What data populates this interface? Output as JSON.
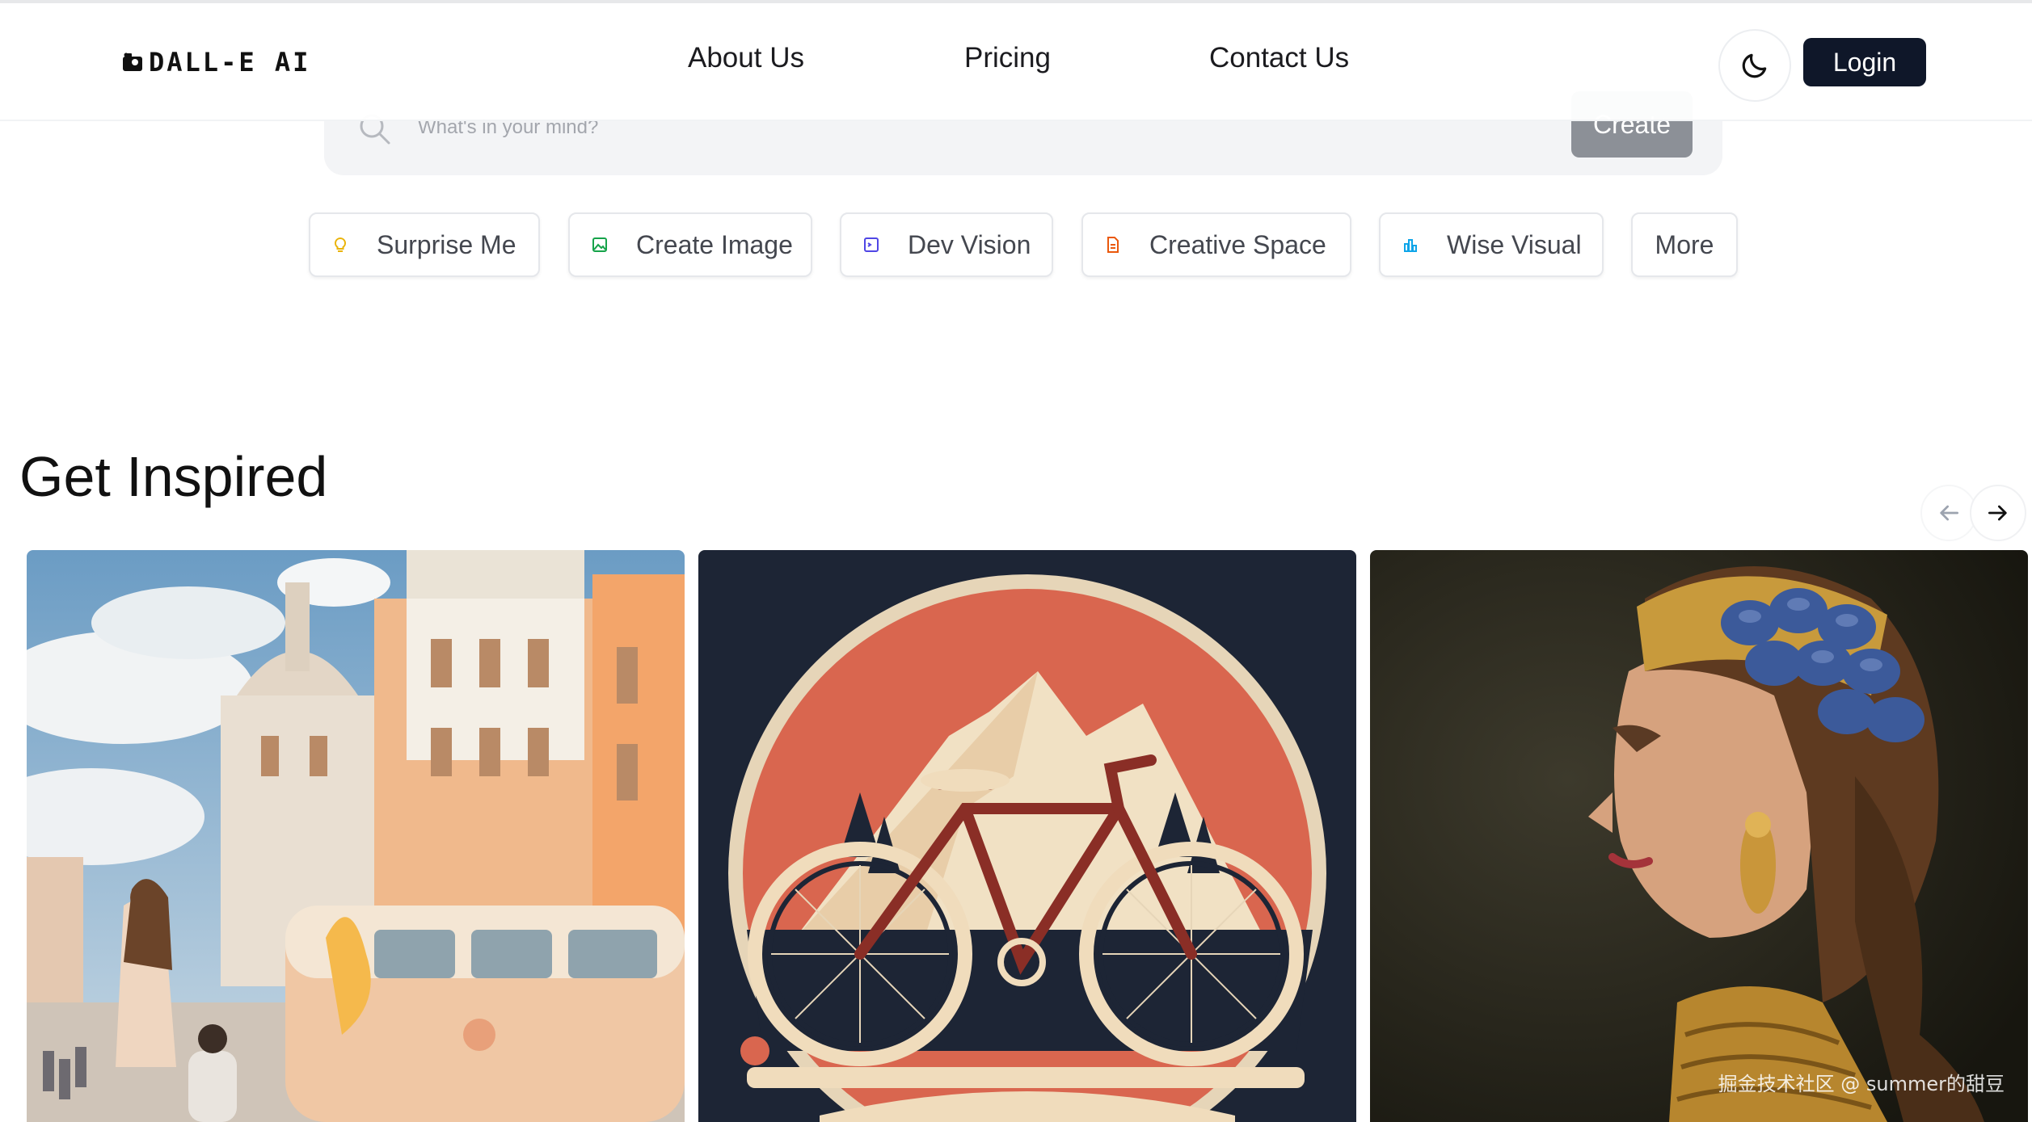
{
  "header": {
    "logo_text": "DALL-E AI",
    "nav": [
      "About Us",
      "Pricing",
      "Contact Us"
    ],
    "theme_icon": "moon-icon",
    "login_label": "Login"
  },
  "search": {
    "placeholder": "What's in your mind?",
    "button_label": "Create"
  },
  "chips": [
    {
      "label": "Surprise Me",
      "icon": "lightbulb-icon",
      "color": "#eab308"
    },
    {
      "label": "Create Image",
      "icon": "image-icon",
      "color": "#16a34a"
    },
    {
      "label": "Dev Vision",
      "icon": "terminal-icon",
      "color": "#4f46e5"
    },
    {
      "label": "Creative Space",
      "icon": "document-icon",
      "color": "#ea580c"
    },
    {
      "label": "Wise Visual",
      "icon": "bar-chart-icon",
      "color": "#0ea5e9"
    },
    {
      "label": "More",
      "icon": "",
      "color": ""
    }
  ],
  "inspired": {
    "title": "Get Inspired",
    "prev_icon": "arrow-left-icon",
    "next_icon": "arrow-right-icon"
  },
  "watermark": "掘金技术社区 @ summer的甜豆"
}
